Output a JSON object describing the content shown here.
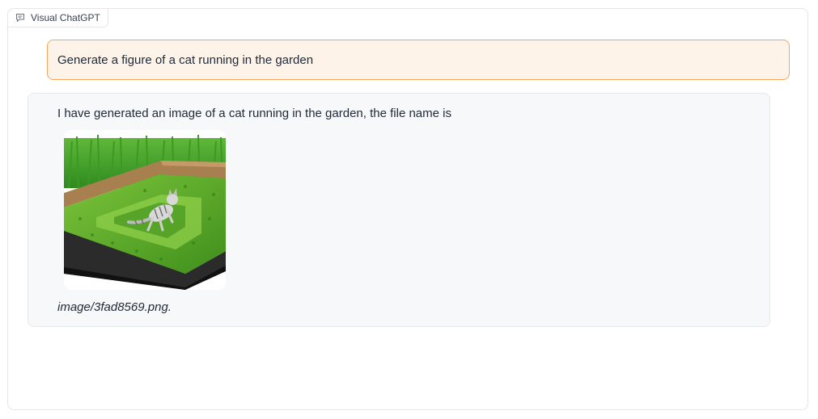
{
  "panel": {
    "label": "Visual ChatGPT",
    "icon": "chat-icon"
  },
  "messages": [
    {
      "role": "user",
      "text": "Generate a figure of a cat running in the garden"
    },
    {
      "role": "bot",
      "text": "I have generated an image of a cat running in the garden, the file name is",
      "image_alt": "cat-in-garden-image",
      "filename": "image/3fad8569.png."
    }
  ],
  "colors": {
    "user_bubble_bg": "#fef3e9",
    "user_bubble_border": "#f6a661",
    "bot_bubble_bg": "#f7f8fa"
  }
}
